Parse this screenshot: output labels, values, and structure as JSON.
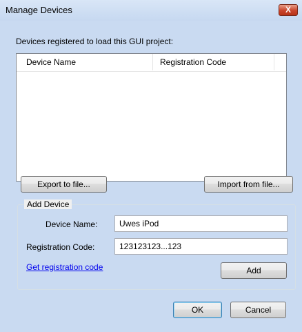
{
  "window": {
    "title": "Manage Devices",
    "close_glyph": "X"
  },
  "main": {
    "description": "Devices registered to load this GUI project:",
    "list": {
      "columns": [
        "Device Name",
        "Registration Code"
      ],
      "rows": []
    },
    "export_button": "Export to file...",
    "import_button": "Import from file..."
  },
  "add_device": {
    "group_title": "Add Device",
    "device_name_label": "Device Name:",
    "device_name_value": "Uwes iPod",
    "reg_code_label": "Registration Code:",
    "reg_code_value": "123123123...123",
    "get_code_link": "Get registration code",
    "add_button": "Add"
  },
  "footer": {
    "ok_button": "OK",
    "cancel_button": "Cancel"
  },
  "colors": {
    "accent": "#3c7fb1",
    "link": "#0000ee",
    "close": "#c9442b"
  }
}
